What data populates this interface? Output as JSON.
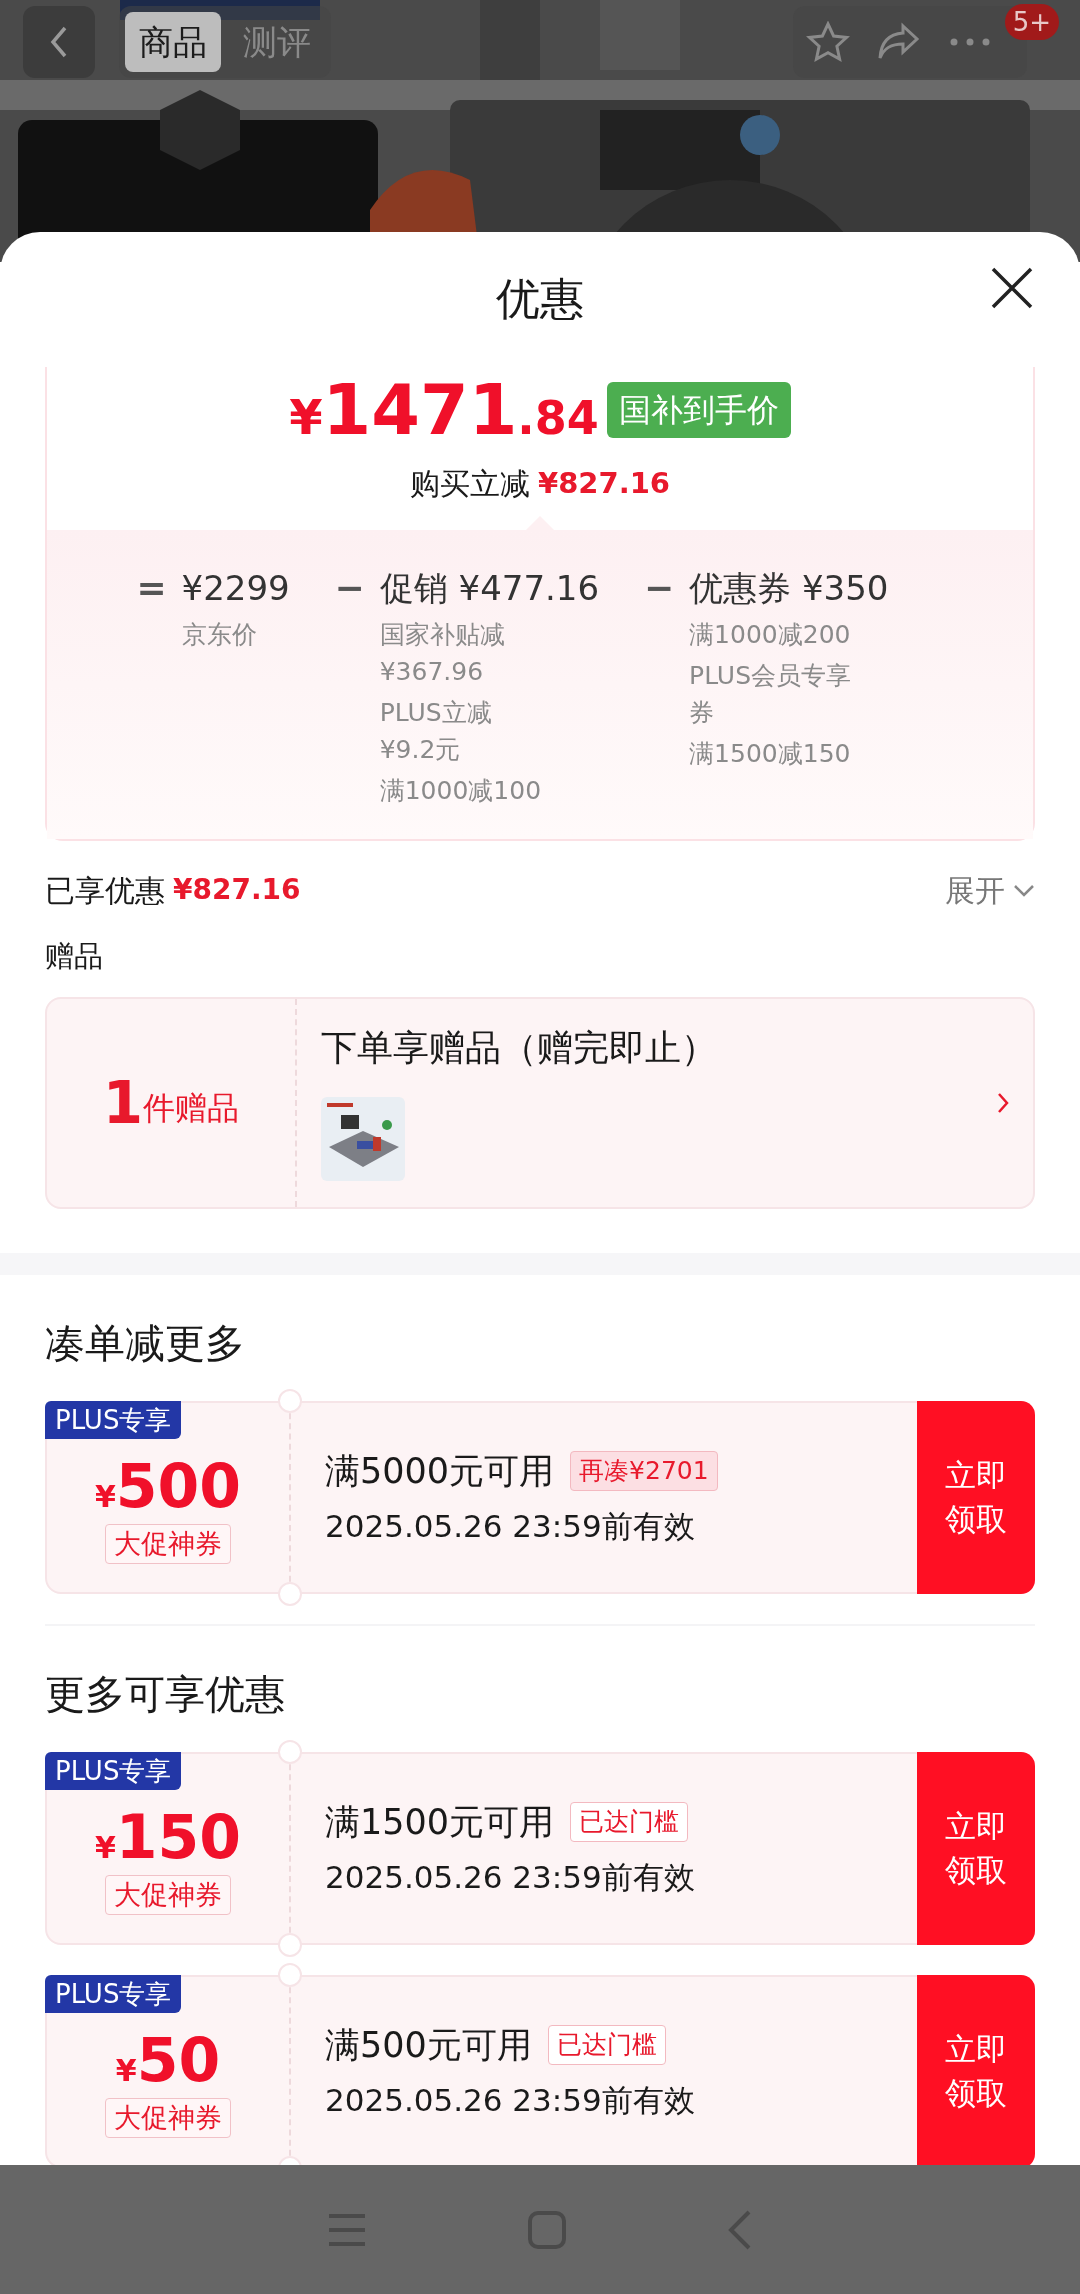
{
  "top_bar": {
    "tabs": [
      {
        "label": "商品",
        "selected": true
      },
      {
        "label": "测评",
        "selected": false
      }
    ],
    "badge": "5+"
  },
  "sheet": {
    "title": "优惠"
  },
  "price_card": {
    "price_currency": "¥",
    "price_integer": "1471",
    "price_decimal": ".84",
    "price_tag": "国补到手价",
    "saving_label": "购买立减",
    "saving_amount": "¥827.16",
    "breakdown": [
      {
        "operator": "=",
        "title": "¥2299",
        "details": [
          [
            "京东价"
          ]
        ]
      },
      {
        "operator": "−",
        "title": "促销 ¥477.16",
        "details": [
          [
            "国家补贴减",
            "¥367.96"
          ],
          [
            "PLUS立减",
            "¥9.2元"
          ],
          [
            "满1000减100"
          ]
        ]
      },
      {
        "operator": "−",
        "title": "优惠券 ¥350",
        "details": [
          [
            "满1000减200"
          ],
          [
            "PLUS会员专享",
            "券"
          ],
          [
            "满1500减150"
          ]
        ]
      }
    ]
  },
  "savings_row": {
    "label": "已享优惠",
    "amount": "¥827.16",
    "toggle": "展开",
    "expanded": false
  },
  "gifts": {
    "section_title": "赠品",
    "count": "1",
    "count_label": "件赠品",
    "title": "下单享赠品（赠完即止）"
  },
  "coupon_sections": [
    {
      "title": "凑单减更多",
      "coupons": [
        {
          "tag": "PLUS专享",
          "currency": "¥",
          "amount": "500",
          "type": "大促神券",
          "condition": "满5000元可用",
          "note": "再凑¥2701",
          "kind": "shortfall",
          "validity": "2025.05.26 23:59前有效",
          "button": "立即领取"
        }
      ]
    },
    {
      "title": "更多可享优惠",
      "coupons": [
        {
          "tag": "PLUS专享",
          "currency": "¥",
          "amount": "150",
          "type": "大促神券",
          "condition": "满1500元可用",
          "note": "已达门槛",
          "kind": "reached",
          "validity": "2025.05.26 23:59前有效",
          "button": "立即领取"
        },
        {
          "tag": "PLUS专享",
          "currency": "¥",
          "amount": "50",
          "type": "大促神券",
          "condition": "满500元可用",
          "note": "已达门槛",
          "kind": "reached",
          "validity": "2025.05.26 23:59前有效",
          "button": "立即领取"
        }
      ]
    }
  ]
}
